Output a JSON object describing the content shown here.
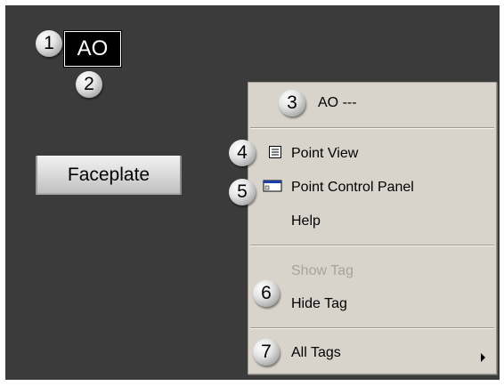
{
  "callouts": [
    "1",
    "2",
    "3",
    "4",
    "5",
    "6",
    "7"
  ],
  "tag": {
    "label": "AO"
  },
  "faceplate": {
    "label": "Faceplate"
  },
  "menu": {
    "header": "AO ---",
    "point_view": "Point View",
    "point_control_panel": "Point Control Panel",
    "help": "Help",
    "show_tag": "Show Tag",
    "hide_tag": "Hide Tag",
    "all_tags": "All Tags"
  },
  "colors": {
    "background": "#3b3b3b",
    "menu_background": "#d8d4cc",
    "disabled_text": "#a7a39c",
    "tag_background": "#000000",
    "tag_text": "#ffffff"
  },
  "icons": {
    "point_view": "point-view-icon",
    "point_control_panel": "control-panel-icon",
    "all_tags": "submenu-arrow-icon"
  }
}
